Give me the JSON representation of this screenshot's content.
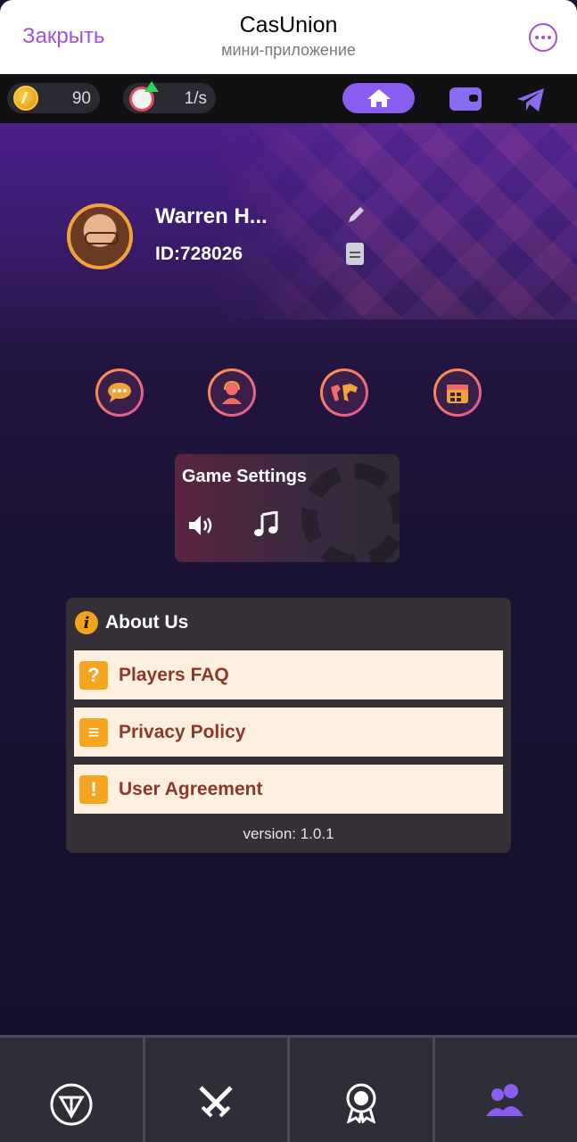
{
  "telegram": {
    "close_label": "Закрыть",
    "title": "CasUnion",
    "subtitle": "мини-приложение"
  },
  "topbar": {
    "coins_value": "90",
    "rate_value": "1/s"
  },
  "profile": {
    "username": "Warren H...",
    "user_id": "ID:728026"
  },
  "quick_actions": [
    {
      "icon": "chat-bubble-icon"
    },
    {
      "icon": "support-agent-icon"
    },
    {
      "icon": "world-map-icon"
    },
    {
      "icon": "calendar-icon"
    }
  ],
  "game_settings": {
    "title": "Game Settings",
    "sound_icon": "speaker-icon",
    "music_icon": "music-note-icon"
  },
  "about": {
    "title": "About Us",
    "items": [
      {
        "label": "Players FAQ",
        "icon": "question-icon",
        "glyph": "?"
      },
      {
        "label": "Privacy Policy",
        "icon": "privacy-doc-icon",
        "glyph": "≡"
      },
      {
        "label": "User Agreement",
        "icon": "exclamation-icon",
        "glyph": "!"
      }
    ],
    "version": "version: 1.0.1"
  },
  "bottom_nav": [
    {
      "icon": "ton-icon"
    },
    {
      "icon": "crossed-swords-icon"
    },
    {
      "icon": "award-icon"
    },
    {
      "icon": "friends-icon",
      "active": true
    }
  ],
  "colors": {
    "accent_purple": "#8a5cf0",
    "telegram_accent": "#a64fd8",
    "about_row_bg": "#fdf0df",
    "about_row_text": "#8a3a26",
    "icon_orange": "#f5a520"
  }
}
